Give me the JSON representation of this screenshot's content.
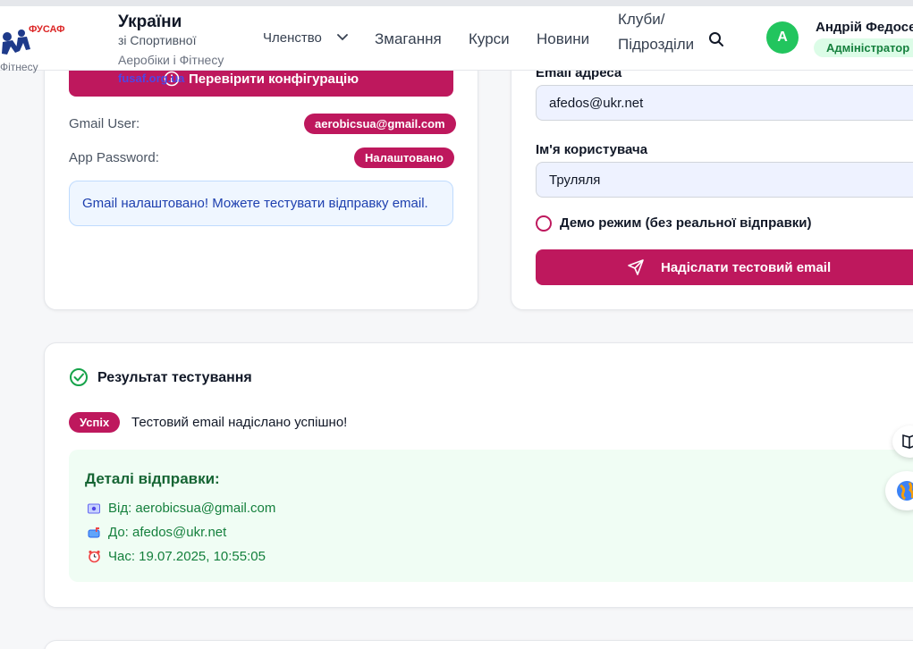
{
  "header": {
    "brand_title": "України",
    "brand_sub1": "зі Спортивної",
    "brand_sub2": "Аеробіки і Фітнесу",
    "brand_link": "fusaf.org.ua",
    "logo_text": "ФУСАФ",
    "nav": {
      "membership": "Членство",
      "competitions": "Змагання",
      "courses": "Курси",
      "news": "Новини",
      "clubs_line1": "Клуби/",
      "clubs_line2": "Підрозділи"
    },
    "user": {
      "avatar_letter": "А",
      "name": "Андрій Федосе",
      "role": "Адміністратор"
    },
    "side_text": "Фітнесу"
  },
  "config_card": {
    "check_button": "Перевірити конфігурацію",
    "gmail_user_label": "Gmail User:",
    "gmail_user_value": "aerobicsua@gmail.com",
    "app_password_label": "App Password:",
    "app_password_value": "Налаштовано",
    "info_message": "Gmail налаштовано! Можете тестувати відправку email."
  },
  "test_form": {
    "email_label": "Email адреса",
    "email_value": "afedos@ukr.net",
    "username_label": "Ім'я користувача",
    "username_value": "Труляля",
    "demo_label": "Демо режим (без реальної відправки)",
    "send_button": "Надіслати тестовий email"
  },
  "result": {
    "title": "Результат тестування",
    "badge": "Успіх",
    "message": "Тестовий email надіслано успішно!",
    "details_title": "Деталі відправки:",
    "from": "Від: aerobicsua@gmail.com",
    "to": "До: afedos@ukr.net",
    "time": "Час: 19.07.2025, 10:55:05"
  },
  "colors": {
    "primary": "#be185d",
    "success_bg": "#f0fdf4",
    "success_text": "#15803d",
    "info_bg": "#eff6ff",
    "info_text": "#1e40af"
  }
}
